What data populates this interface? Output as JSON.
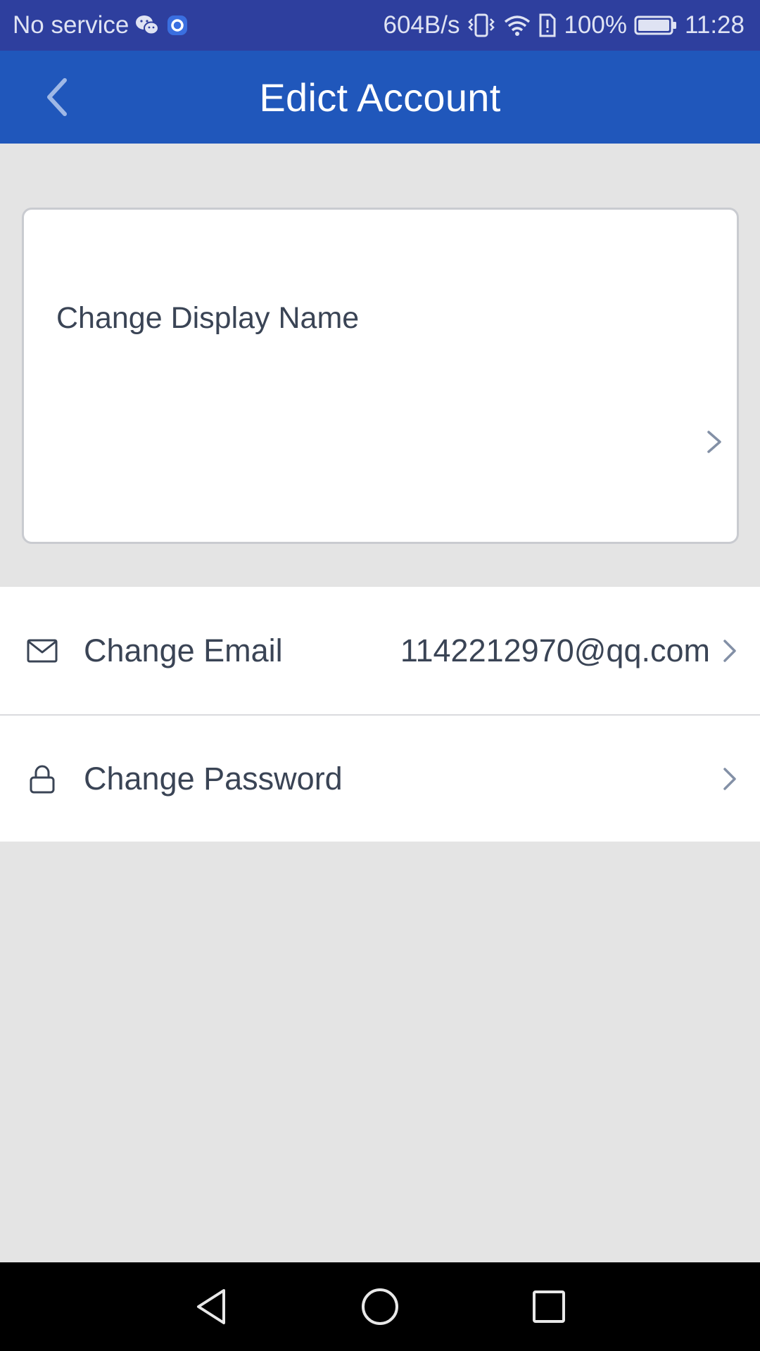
{
  "status_bar": {
    "carrier": "No service",
    "network_speed": "604B/s",
    "battery": "100%",
    "time": "11:28",
    "icons": [
      "wechat-icon",
      "app-notification-icon",
      "vibrate-icon",
      "wifi-icon",
      "sim-alert-icon",
      "battery-icon"
    ]
  },
  "header": {
    "title": "Edict Account",
    "back_icon": "chevron-left-icon"
  },
  "display_name_card": {
    "label": "Change Display Name",
    "chevron_icon": "chevron-right-icon"
  },
  "settings": {
    "items": [
      {
        "label": "Change Email",
        "value": "1142212970@qq.com",
        "icon": "mail-icon"
      },
      {
        "label": "Change Password",
        "value": "",
        "icon": "lock-icon"
      }
    ]
  },
  "nav_bar": {
    "buttons": [
      "back-triangle-icon",
      "home-circle-icon",
      "recents-square-icon"
    ]
  },
  "colors": {
    "status_bar": "#2e3f9e",
    "header": "#2057bb",
    "background": "#e4e4e4",
    "text": "#3a4455",
    "chevron": "#8390a6"
  }
}
